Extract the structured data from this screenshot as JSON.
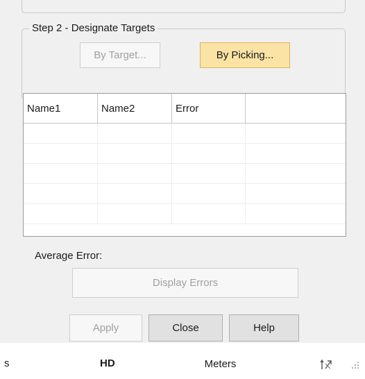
{
  "step2": {
    "title": "Step 2 - Designate Targets",
    "by_target_label": "By Target...",
    "by_picking_label": "By Picking..."
  },
  "grid": {
    "columns": [
      "Name1",
      "Name2",
      "Error",
      ""
    ],
    "rows": [
      [
        "",
        "",
        "",
        ""
      ],
      [
        "",
        "",
        "",
        ""
      ],
      [
        "",
        "",
        "",
        ""
      ],
      [
        "",
        "",
        "",
        ""
      ],
      [
        "",
        "",
        "",
        ""
      ]
    ]
  },
  "average_error": {
    "label": "Average Error:"
  },
  "buttons": {
    "display_errors": "Display Errors",
    "apply": "Apply",
    "close": "Close",
    "help": "Help"
  },
  "statusbar": {
    "left_text": "s",
    "hd": "HD",
    "units": "Meters",
    "icon": "pick-tool-icon"
  },
  "colors": {
    "panel_bg": "#f0f0f0",
    "highlight_button": "#fbe3a6",
    "disabled_text": "#a0a0a0"
  }
}
